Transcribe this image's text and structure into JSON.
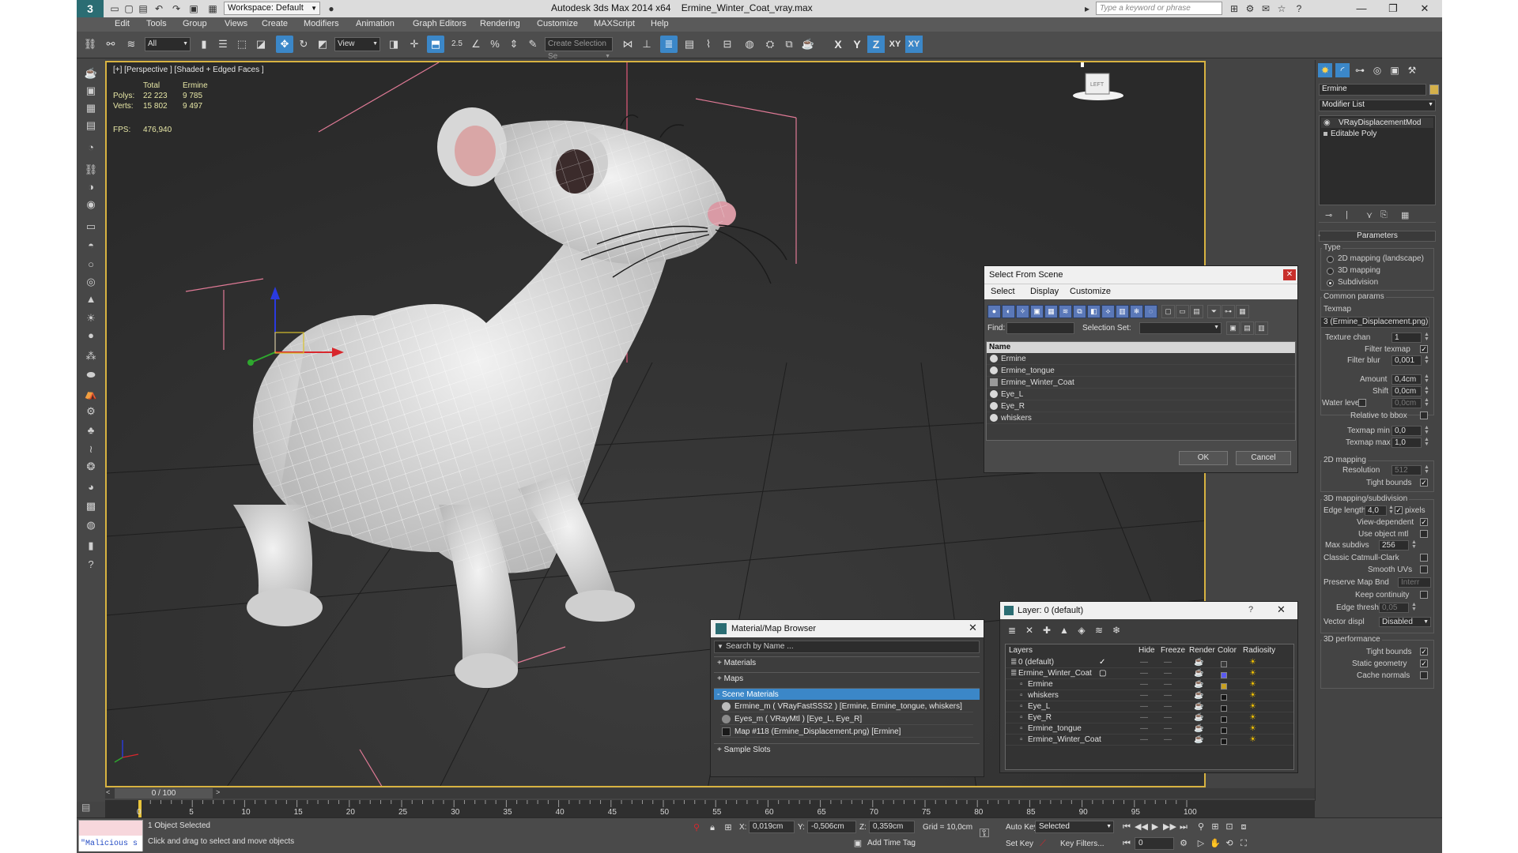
{
  "titlebar": {
    "workspace": "Workspace: Default",
    "app_title": "Autodesk 3ds Max  2014 x64",
    "file_name": "Ermine_Winter_Coat_vray.max",
    "search_placeholder": "Type a keyword or phrase"
  },
  "menu": [
    "Edit",
    "Tools",
    "Group",
    "Views",
    "Create",
    "Modifiers",
    "Animation",
    "Graph Editors",
    "Rendering",
    "Customize",
    "MAXScript",
    "Help"
  ],
  "toolbar": {
    "selection_filter": "All",
    "ref_coord": "View",
    "snap_label": "2.5",
    "named_selection": "Create Selection Se",
    "axes": [
      "X",
      "Y",
      "Z",
      "XY",
      "XY"
    ]
  },
  "viewport": {
    "label": "[+] [Perspective ] [Shaded + Edged Faces ]",
    "stats": {
      "col_total": "Total",
      "col_object": "Ermine",
      "polys_label": "Polys:",
      "polys_total": "22 223",
      "polys_object": "9 785",
      "verts_label": "Verts:",
      "verts_total": "15 802",
      "verts_object": "9 497",
      "fps_label": "FPS:",
      "fps_value": "476,940"
    }
  },
  "select_from_scene": {
    "title": "Select From Scene",
    "menu": [
      "Select",
      "Display",
      "Customize"
    ],
    "find_label": "Find:",
    "selection_set_label": "Selection Set:",
    "column_name": "Name",
    "objects": [
      "Ermine",
      "Ermine_tongue",
      "Ermine_Winter_Coat",
      "Eye_L",
      "Eye_R",
      "whiskers"
    ],
    "ok": "OK",
    "cancel": "Cancel"
  },
  "material_browser": {
    "title": "Material/Map Browser",
    "search_placeholder": "Search by Name ...",
    "sections": {
      "materials": "+ Materials",
      "maps": "+ Maps",
      "scene_materials": "- Scene Materials",
      "sample_slots": "+ Sample Slots"
    },
    "scene_items": [
      "Ermine_m  ( VRayFastSSS2 ) [Ermine, Ermine_tongue, whiskers]",
      "Eyes_m  ( VRayMtl ) [Eye_L, Eye_R]",
      "Map #118 (Ermine_Displacement.png)  [Ermine]"
    ]
  },
  "layers": {
    "title": "Layer: 0 (default)",
    "help": "?",
    "headers": [
      "Layers",
      "Hide",
      "Freeze",
      "Render",
      "Color",
      "Radiosity"
    ],
    "rows": [
      {
        "name": "0 (default)",
        "color": "#3a3a3a"
      },
      {
        "name": "Ermine_Winter_Coat",
        "color": "#5a5af0"
      },
      {
        "name": "Ermine",
        "color": "#c8a020"
      },
      {
        "name": "whiskers",
        "color": "#151515"
      },
      {
        "name": "Eye_L",
        "color": "#151515"
      },
      {
        "name": "Eye_R",
        "color": "#151515"
      },
      {
        "name": "Ermine_tongue",
        "color": "#151515"
      },
      {
        "name": "Ermine_Winter_Coat",
        "color": "#151515"
      }
    ]
  },
  "command_panel": {
    "object_name": "Ermine",
    "object_color": "#d4b04a",
    "modifier_list": "Modifier List",
    "stack": [
      "VRayDisplacementMod",
      "Editable Poly"
    ],
    "rollout": "Parameters",
    "type_group": "Type",
    "type_options": [
      "2D mapping (landscape)",
      "3D mapping",
      "Subdivision"
    ],
    "common_group": "Common params",
    "texmap_label": "Texmap",
    "texmap_value": "3 (Ermine_Displacement.png)",
    "texture_chan_label": "Texture chan",
    "texture_chan_value": "1",
    "filter_texmap_label": "Filter texmap",
    "filter_blur_label": "Filter blur",
    "filter_blur_value": "0,001",
    "amount_label": "Amount",
    "amount_value": "0,4cm",
    "shift_label": "Shift",
    "shift_value": "0,0cm",
    "water_level_label": "Water level",
    "water_level_value": "0,0cm",
    "relative_bbox_label": "Relative to bbox",
    "texmap_min_label": "Texmap min",
    "texmap_min_value": "0,0",
    "texmap_max_label": "Texmap max",
    "texmap_max_value": "1,0",
    "mapping2d_group": "2D mapping",
    "resolution_label": "Resolution",
    "resolution_value": "512",
    "tight_bounds_label": "Tight bounds",
    "mapping3d_group": "3D mapping/subdivision",
    "edge_length_label": "Edge length",
    "edge_length_value": "4,0",
    "pixels_label": "pixels",
    "view_dependent_label": "View-dependent",
    "use_object_mtl_label": "Use object mtl",
    "max_subdivs_label": "Max subdivs",
    "max_subdivs_value": "256",
    "classic_catmull_label": "Classic Catmull-Clark",
    "smooth_uvs_label": "Smooth UVs",
    "preserve_map_bnd_label": "Preserve Map Bnd",
    "preserve_map_bnd_value": "Interr",
    "keep_continuity_label": "Keep continuity",
    "edge_thresh_label": "Edge thresh",
    "edge_thresh_value": "0,05",
    "vector_displ_label": "Vector displ",
    "vector_displ_value": "Disabled",
    "perf_group": "3D performance",
    "perf_tight_bounds_label": "Tight bounds",
    "static_geometry_label": "Static geometry",
    "cache_normals_label": "Cache normals"
  },
  "timeline": {
    "frame": "0 / 100",
    "ticks": [
      "0",
      "5",
      "10",
      "15",
      "20",
      "25",
      "30",
      "35",
      "40",
      "45",
      "50",
      "55",
      "60",
      "65",
      "70",
      "75",
      "80",
      "85",
      "90",
      "95",
      "100"
    ]
  },
  "status": {
    "maxscript_text": "\"Malicious s",
    "selection_count": "1 Object Selected",
    "prompt": "Click and drag to select and move objects",
    "x_label": "X:",
    "x_value": "0,019cm",
    "y_label": "Y:",
    "y_value": "-0,506cm",
    "z_label": "Z:",
    "z_value": "0,359cm",
    "grid": "Grid = 10,0cm",
    "add_time_tag": "Add Time Tag",
    "auto_key": "Auto Key",
    "selected": "Selected",
    "set_key": "Set Key",
    "key_filters": "Key Filters...",
    "frame_field": "0"
  }
}
